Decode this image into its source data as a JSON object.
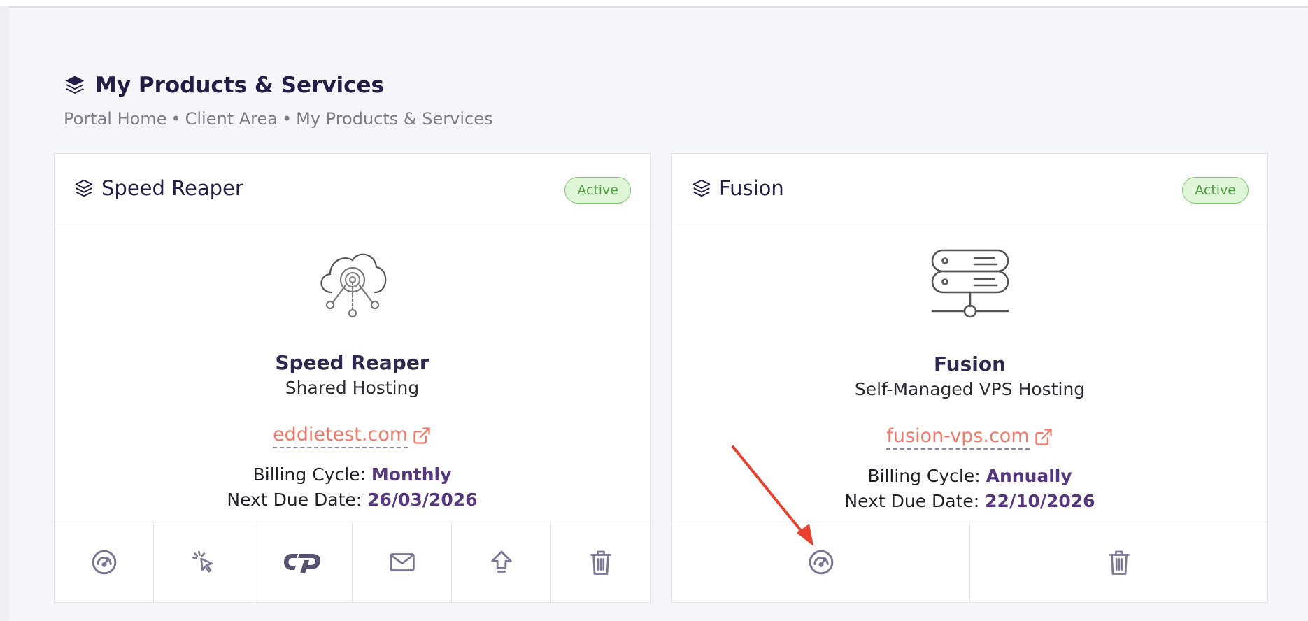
{
  "page": {
    "title": "My Products & Services",
    "breadcrumb": [
      "Portal Home",
      "Client Area",
      "My Products & Services"
    ]
  },
  "colors": {
    "accent": "#56367f",
    "link": "#ef7a6a",
    "status_active": "#4f9e3f",
    "annotation_arrow": "#e8412f"
  },
  "cards": [
    {
      "header_title": "Speed Reaper",
      "status": "Active",
      "icon": "cloud-network-icon",
      "product_name": "Speed Reaper",
      "product_type": "Shared Hosting",
      "domain": "eddietest.com",
      "billing_label": "Billing Cycle:",
      "billing_cycle": "Monthly",
      "due_label": "Next Due Date:",
      "next_due": "26/03/2026",
      "actions": [
        "dashboard-icon",
        "login-pointer-icon",
        "cpanel-icon",
        "email-icon",
        "upgrade-icon",
        "delete-icon"
      ]
    },
    {
      "header_title": "Fusion",
      "status": "Active",
      "icon": "server-stack-icon",
      "product_name": "Fusion",
      "product_type": "Self-Managed VPS Hosting",
      "domain": "fusion-vps.com",
      "billing_label": "Billing Cycle:",
      "billing_cycle": "Annually",
      "due_label": "Next Due Date:",
      "next_due": "22/10/2026",
      "actions": [
        "dashboard-icon",
        "delete-icon"
      ]
    }
  ]
}
